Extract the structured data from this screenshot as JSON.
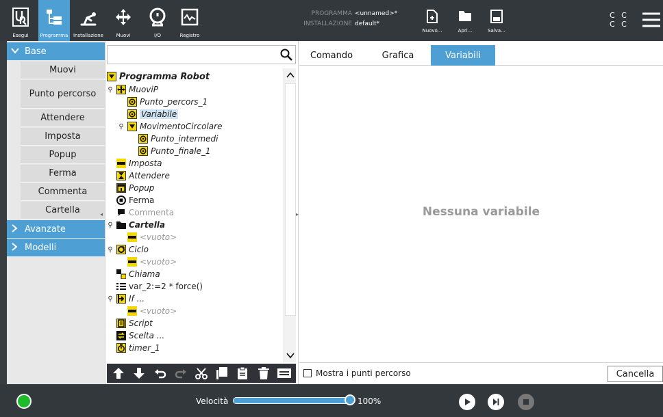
{
  "topbar": {
    "nav": [
      {
        "label": "Esegui",
        "icon": "ur-logo-icon"
      },
      {
        "label": "Programma",
        "icon": "program-tree-icon"
      },
      {
        "label": "Installazione",
        "icon": "robot-arm-icon"
      },
      {
        "label": "Muovi",
        "icon": "move-arrows-icon"
      },
      {
        "label": "I/O",
        "icon": "io-icon"
      },
      {
        "label": "Registro",
        "icon": "log-chart-icon"
      }
    ],
    "program_key": "PROGRAMMA",
    "program_val": "<unnamed>*",
    "install_key": "INSTALLAZIONE",
    "install_val": "default*",
    "file_buttons": [
      {
        "label": "Nuovo...",
        "icon": "new-file-icon"
      },
      {
        "label": "Apri...",
        "icon": "folder-icon"
      },
      {
        "label": "Salva...",
        "icon": "save-icon"
      }
    ],
    "cc_line1": "C C",
    "cc_line2": "C C"
  },
  "sidebar": {
    "base_label": "Base",
    "base_items": [
      "Muovi",
      "Punto percorso",
      "Attendere",
      "Imposta",
      "Popup",
      "Ferma",
      "Commenta",
      "Cartella"
    ],
    "advanced_label": "Avanzate",
    "templates_label": "Modelli"
  },
  "tree": {
    "search_value": "",
    "root": "Programma Robot",
    "nodes": [
      {
        "label": "MuoviP",
        "icon": "move-icon",
        "level": 1
      },
      {
        "label": "Punto_percors_1",
        "icon": "waypoint-icon",
        "level": 2
      },
      {
        "label": "Variabile",
        "icon": "waypoint-icon",
        "level": 2,
        "selected": true
      },
      {
        "label": "MovimentoCircolare",
        "icon": "circle-move-icon",
        "level": 2
      },
      {
        "label": "Punto_intermedi",
        "icon": "waypoint-icon",
        "level": 3
      },
      {
        "label": "Punto_finale_1",
        "icon": "waypoint-icon",
        "level": 3
      },
      {
        "label": "Imposta",
        "icon": "set-icon",
        "level": 1
      },
      {
        "label": "Attendere",
        "icon": "hourglass-icon",
        "level": 1
      },
      {
        "label": "Popup",
        "icon": "popup-icon",
        "level": 1
      },
      {
        "label": "Ferma",
        "icon": "stop-icon",
        "level": 1
      },
      {
        "label": "Commenta",
        "icon": "comment-icon",
        "level": 1
      },
      {
        "label": "Cartella",
        "icon": "folder-icon",
        "level": 1
      },
      {
        "label": "<vuoto>",
        "icon": "empty-icon",
        "level": 2
      },
      {
        "label": "Ciclo",
        "icon": "loop-icon",
        "level": 1
      },
      {
        "label": "<vuoto>",
        "icon": "empty-icon",
        "level": 2
      },
      {
        "label": "Chiama",
        "icon": "call-icon",
        "level": 1
      },
      {
        "label": "var_2:=2 * force()",
        "icon": "assignment-icon",
        "level": 1
      },
      {
        "label": "If ...",
        "icon": "if-icon",
        "level": 1
      },
      {
        "label": "<vuoto>",
        "icon": "empty-icon",
        "level": 2
      },
      {
        "label": "Script",
        "icon": "script-icon",
        "level": 1
      },
      {
        "label": "Scelta ...",
        "icon": "switch-icon",
        "level": 1
      },
      {
        "label": "timer_1",
        "icon": "timer-icon",
        "level": 1
      }
    ]
  },
  "tabs": [
    "Comando",
    "Grafica",
    "Variabili"
  ],
  "active_tab": "Variabili",
  "empty_message": "Nessuna variabile",
  "show_waypoints_label": "Mostra i punti percorso",
  "cancel_label": "Cancella",
  "footer": {
    "speed_label": "Velocità",
    "speed_value": "100%",
    "speed_fraction": 1.0
  },
  "colors": {
    "accent": "#4d9fd4",
    "topbar": "#33383d",
    "power_on": "#1dba2b",
    "node_yellow": "#f5d800"
  }
}
